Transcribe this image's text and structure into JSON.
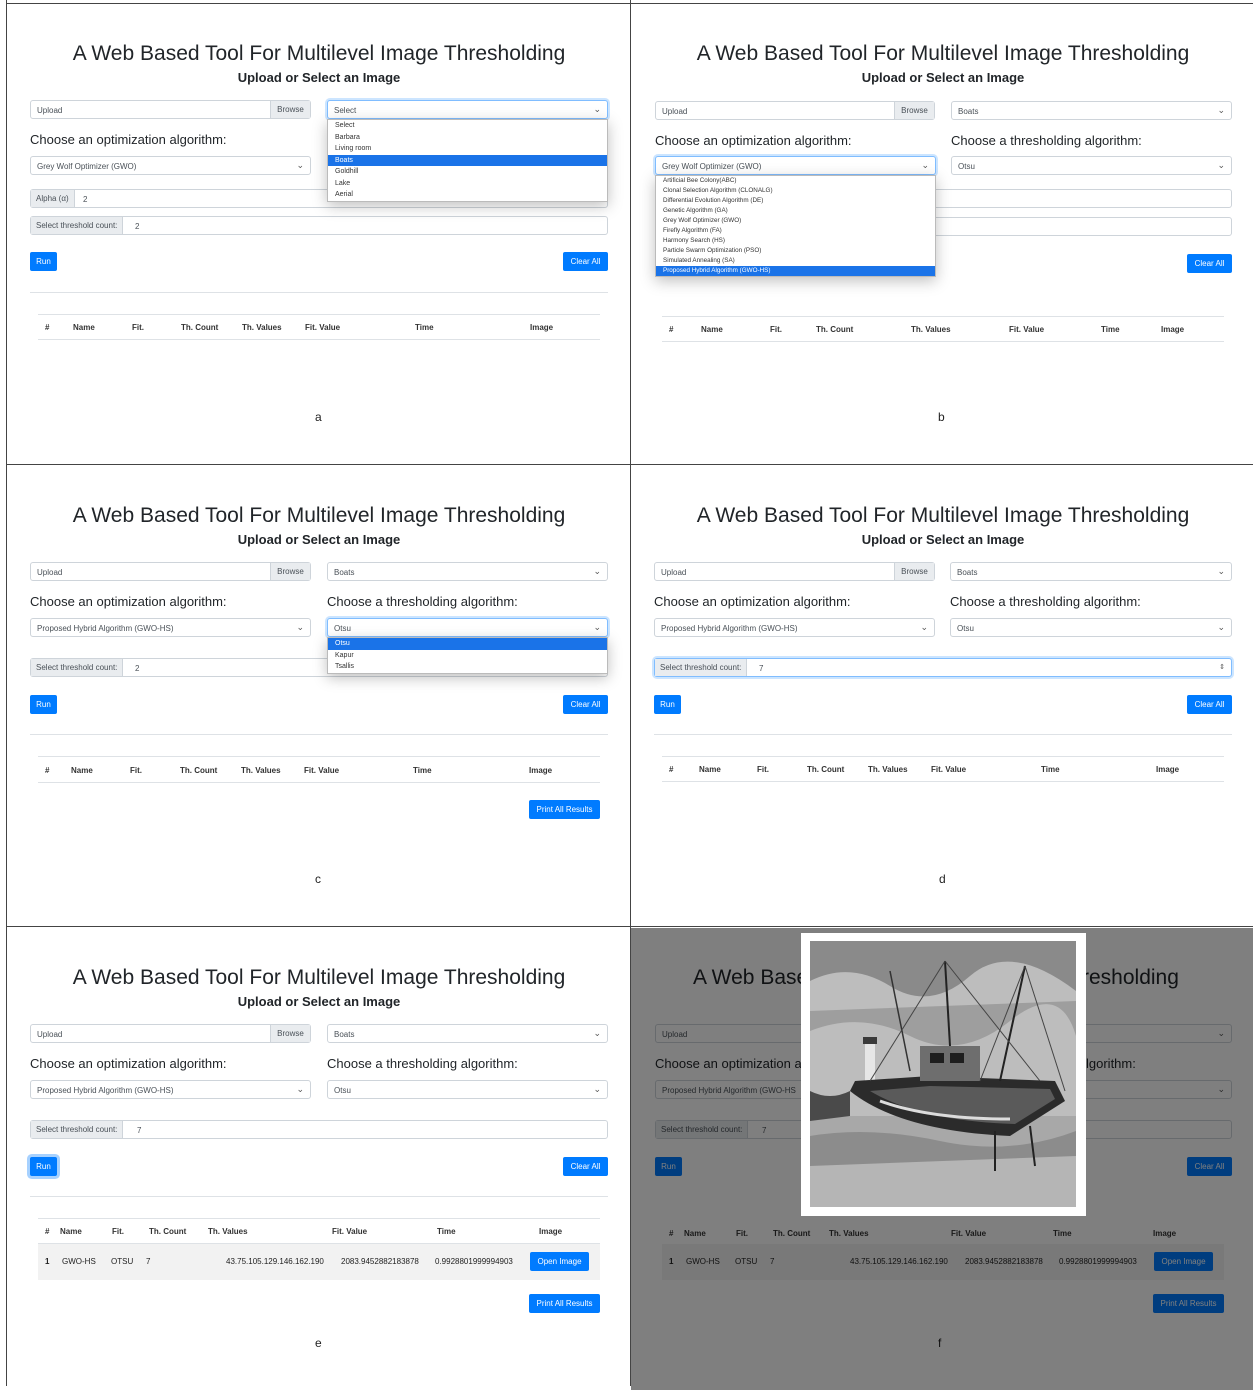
{
  "title": "A Web Based Tool For Multilevel Image Thresholding",
  "subtitle": "Upload or Select an Image",
  "upload_placeholder": "Upload",
  "browse_label": "Browse",
  "opt_label": "Choose an optimization algorithm:",
  "thr_label": "Choose a thresholding algorithm:",
  "alpha_label": "Alpha (α)",
  "threshold_label": "Select threshold count:",
  "run_label": "Run",
  "clear_label": "Clear All",
  "print_label": "Print All Results",
  "open_image_label": "Open Image",
  "table_headers": [
    "#",
    "Name",
    "Fit.",
    "Th. Count",
    "Th. Values",
    "Fit. Value",
    "Time",
    "Image"
  ],
  "images": [
    "Select",
    "Barbara",
    "Living room",
    "Boats",
    "Goldhill",
    "Lake",
    "Aerial"
  ],
  "algorithms": [
    "Artificial Bee Colony(ABC)",
    "Clonal Selection Algorithm (CLONALG)",
    "Differential Evolution Algorithm (DE)",
    "Genetic Algorithm (GA)",
    "Grey Wolf Optimizer (GWO)",
    "Firefly Algorithm (FA)",
    "Harmony Search (HS)",
    "Particle Swarm Optimization (PSO)",
    "Simulated Annealing (SA)",
    "Proposed Hybrid Algorithm (GWO-HS)"
  ],
  "thresholding": [
    "Otsu",
    "Kapur",
    "Tsallis"
  ],
  "panels": {
    "a": {
      "caption": "a",
      "image_value": "Select",
      "opt_value": "Grey Wolf Optimizer (GWO)",
      "alpha_value": "2",
      "threshold_value": "2"
    },
    "b": {
      "caption": "b",
      "image_value": "Boats",
      "opt_value": "Grey Wolf Optimizer (GWO)",
      "thr_value": "Otsu"
    },
    "c": {
      "caption": "c",
      "image_value": "Boats",
      "opt_value": "Proposed Hybrid Algorithm (GWO-HS)",
      "thr_value": "Otsu",
      "threshold_value": "2"
    },
    "d": {
      "caption": "d",
      "image_value": "Boats",
      "opt_value": "Proposed Hybrid Algorithm (GWO-HS)",
      "thr_value": "Otsu",
      "threshold_value": "7"
    },
    "e": {
      "caption": "e",
      "image_value": "Boats",
      "opt_value": "Proposed Hybrid Algorithm (GWO-HS)",
      "thr_value": "Otsu",
      "threshold_value": "7"
    },
    "f": {
      "caption": "f",
      "title_left": "A Web Base",
      "title_right": "resholding",
      "opt_label_part": "Choose an optimization al",
      "thr_label_part": "lgorithm:",
      "opt_value_part": "Proposed Hybrid Algorithm (GWO-HS",
      "threshold_value": "7"
    }
  },
  "result_row": {
    "index": "1",
    "name": "GWO-HS",
    "fit": "OTSU",
    "th_count": "7",
    "th_values": "43.75.105.129.146.162.190",
    "fit_value": "2083.9452882183878",
    "time": "0.9928801999994903"
  },
  "colors": {
    "primary": "#007bff",
    "selected_option": "#1a73e8"
  }
}
